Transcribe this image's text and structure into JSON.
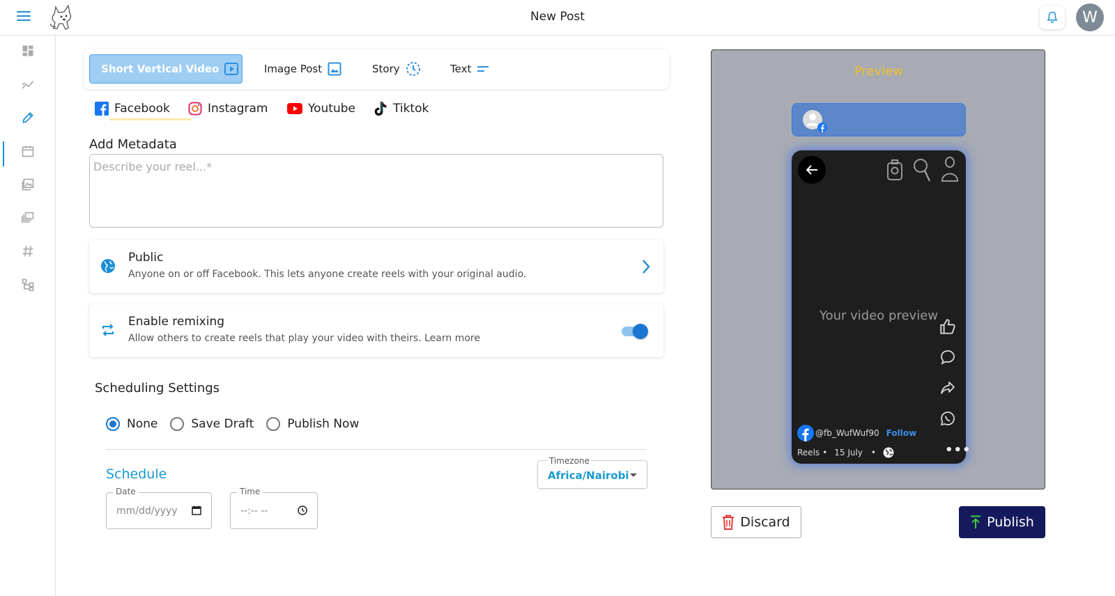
{
  "header": {
    "title": "New Post",
    "avatar_initial": "W"
  },
  "sidebar": {
    "items": [
      "dashboard-icon",
      "analytics-icon",
      "edit-icon",
      "calendar-icon",
      "gallery-icon",
      "library-icon",
      "hashtag-icon",
      "workflow-icon"
    ],
    "active_index": 2
  },
  "post_types": [
    {
      "label": "Short Vertical Video",
      "icon": "video-icon",
      "active": true
    },
    {
      "label": "Image Post",
      "icon": "image-icon",
      "active": false
    },
    {
      "label": "Story",
      "icon": "story-icon",
      "active": false
    },
    {
      "label": "Text",
      "icon": "text-icon",
      "active": false
    }
  ],
  "platforms": [
    {
      "label": "Facebook",
      "active": true
    },
    {
      "label": "Instagram",
      "active": false
    },
    {
      "label": "Youtube",
      "active": false
    },
    {
      "label": "Tiktok",
      "active": false
    }
  ],
  "metadata": {
    "heading": "Add Metadata",
    "placeholder": "Describe your reel...*"
  },
  "audience": {
    "title": "Public",
    "description": "Anyone on or off Facebook. This lets anyone create reels with your original audio."
  },
  "remix": {
    "title": "Enable remixing",
    "description": "Allow others to create reels that play your video with theirs. Learn more",
    "enabled": true
  },
  "scheduling": {
    "heading": "Scheduling Settings",
    "options": [
      "None",
      "Save Draft",
      "Publish Now"
    ],
    "selected": "None",
    "schedule_heading": "Schedule",
    "date_label": "Date",
    "date_placeholder": "mm/dd/yyyy",
    "time_label": "Time",
    "time_placeholder": "--:-- --",
    "timezone_label": "Timezone",
    "timezone_value": "Africa/Nairobi"
  },
  "preview": {
    "title": "Preview",
    "video_placeholder": "Your video preview",
    "username": "@fb_WufWuf90",
    "follow": "Follow",
    "reels": "Reels",
    "date": "15 July",
    "more": "•••"
  },
  "actions": {
    "discard": "Discard",
    "publish": "Publish"
  },
  "colors": {
    "accent": "#1a8fd6",
    "publish_bg": "#151a5c",
    "preview_title": "#f2bf2c",
    "discard_icon": "#e53935",
    "publish_icon": "#3ecf3e"
  }
}
